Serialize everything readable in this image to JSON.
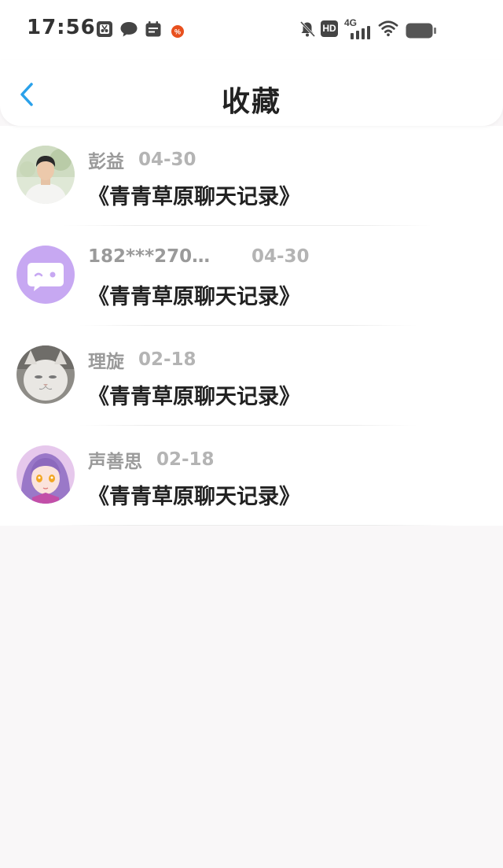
{
  "status_bar": {
    "time": "17:56",
    "network_label": "4G",
    "hd_label": "HD"
  },
  "header": {
    "title": "收藏"
  },
  "favorites": [
    {
      "name": "彭益",
      "date": "04-30",
      "title": "《青青草原聊天记录》",
      "avatar": "photo-man-avatar"
    },
    {
      "name": "182***270…",
      "date": "04-30",
      "title": "《青青草原聊天记录》",
      "avatar": "chat-bubble-avatar"
    },
    {
      "name": "理旋",
      "date": "02-18",
      "title": "《青青草原聊天记录》",
      "avatar": "cat-photo-avatar"
    },
    {
      "name": "声善思",
      "date": "02-18",
      "title": "《青青草原聊天记录》",
      "avatar": "anime-girl-avatar"
    }
  ],
  "colors": {
    "accent": "#2aa1ea",
    "background": "#f9f7f8",
    "title_text": "#222222",
    "meta_text": "#9a9a9a",
    "avatar_purple": "#c7a8f2"
  }
}
